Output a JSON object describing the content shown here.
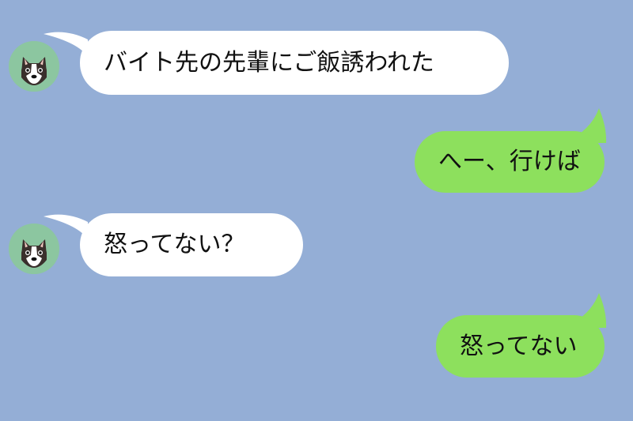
{
  "messages": [
    {
      "direction": "incoming",
      "text": "バイト先の先輩にご飯誘われた"
    },
    {
      "direction": "outgoing",
      "text": "へー、行けば"
    },
    {
      "direction": "incoming",
      "text": "怒ってない？"
    },
    {
      "direction": "outgoing",
      "text": "怒ってない"
    }
  ],
  "avatar_icon": "boston-terrier-dog-icon",
  "colors": {
    "background": "#94aed6",
    "incoming_bubble": "#ffffff",
    "outgoing_bubble": "#8de05d",
    "avatar_bg": "#8cc6a0"
  }
}
